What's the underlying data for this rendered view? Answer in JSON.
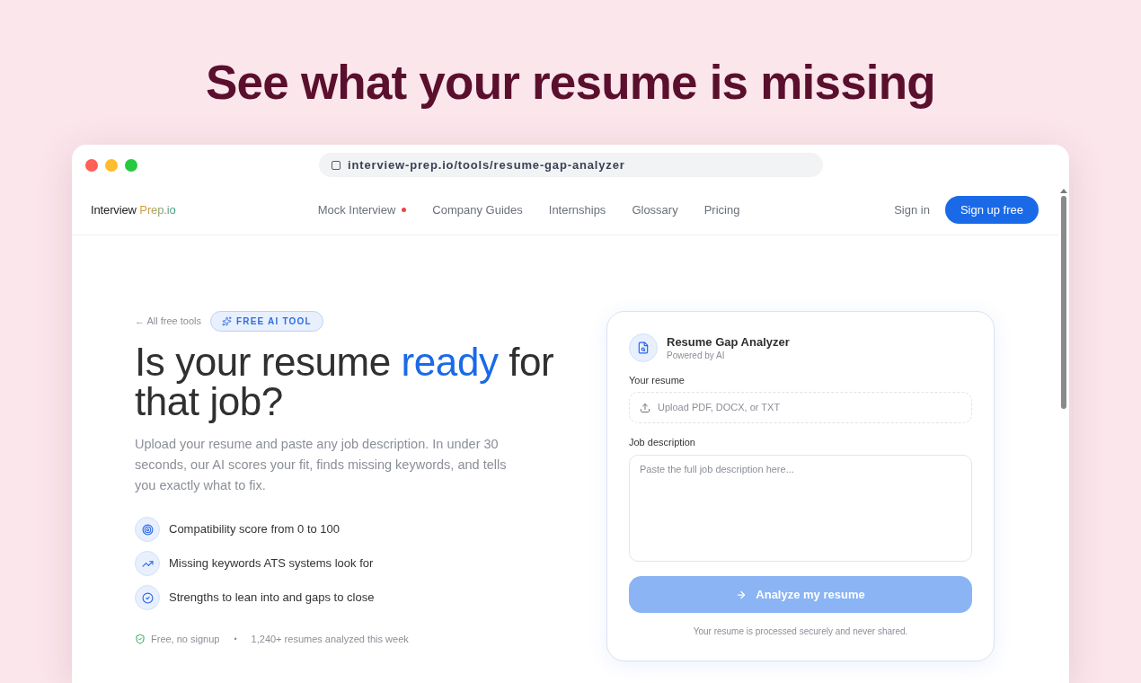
{
  "headline": "See what your resume is missing",
  "browser": {
    "url": "interview-prep.io/tools/resume-gap-analyzer"
  },
  "nav": {
    "logo": {
      "name": "Interview",
      "accent": "Prep.io"
    },
    "links": [
      {
        "label": "Mock Interview",
        "dot": true
      },
      {
        "label": "Company Guides",
        "dot": false
      },
      {
        "label": "Internships",
        "dot": false
      },
      {
        "label": "Glossary",
        "dot": false
      },
      {
        "label": "Pricing",
        "dot": false
      }
    ],
    "sign_in": "Sign in",
    "sign_up": "Sign up free"
  },
  "hero": {
    "back_link": "← All free tools",
    "badge": "FREE AI TOOL",
    "heading": {
      "before": "Is your resume ",
      "highlight": "ready",
      "after": " for that job?"
    },
    "description": "Upload your resume and paste any job description. In under 30 seconds, our AI scores your fit, finds missing keywords, and tells you exactly what to fix.",
    "features": [
      "Compatibility score from 0 to 100",
      "Missing keywords ATS systems look for",
      "Strengths to lean into and gaps to close"
    ],
    "footer": {
      "note": "Free, no signup",
      "separator": "•",
      "stat": "1,240+ resumes analyzed this week"
    }
  },
  "analyzer": {
    "title": "Resume Gap Analyzer",
    "subtitle": "Powered by AI",
    "resume_label": "Your resume",
    "upload_placeholder": "Upload PDF, DOCX, or TXT",
    "job_label": "Job description",
    "job_placeholder": "Paste the full job description here...",
    "submit": {
      "label": "Analyze my resume",
      "disabled": true
    },
    "privacy_note": "Your resume is processed securely and never shared."
  }
}
